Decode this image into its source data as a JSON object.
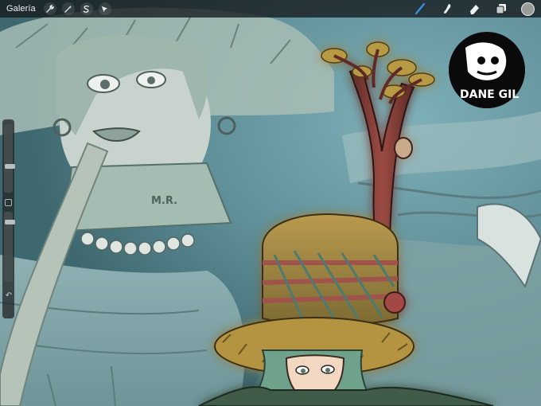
{
  "app": {
    "gallery_label": "Galería"
  },
  "toolbar": {
    "left_tools": [
      {
        "name": "actions",
        "icon": "wrench-icon"
      },
      {
        "name": "adjustments",
        "icon": "magic-wand-icon"
      },
      {
        "name": "selection",
        "icon": "selection-s-icon"
      },
      {
        "name": "transform",
        "icon": "arrow-cursor-icon"
      }
    ],
    "right_tools": [
      {
        "name": "brush",
        "icon": "brush-icon",
        "active": true
      },
      {
        "name": "smudge",
        "icon": "smudge-icon"
      },
      {
        "name": "eraser",
        "icon": "eraser-icon"
      },
      {
        "name": "layers",
        "icon": "layers-icon"
      }
    ],
    "current_color": "#9a9c9c",
    "accent_color": "#3b8fe0"
  },
  "sidebar": {
    "brush_size_level": 0.3,
    "opacity_level": 0.6,
    "undo_icon": "undo-icon",
    "modify_icon": "square-icon"
  },
  "artwork": {
    "signature_text": "DANE GIL",
    "collar_letters": "M.R."
  }
}
